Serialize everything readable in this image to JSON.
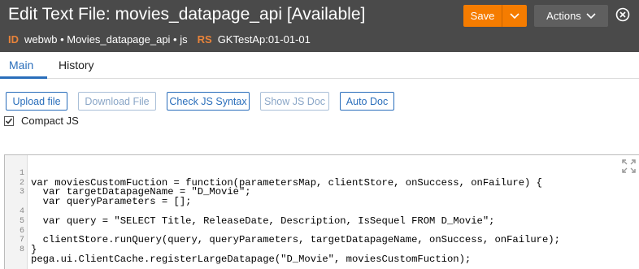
{
  "header": {
    "title": "Edit Text File: movies_datapage_api [Available]",
    "id_tag": "ID",
    "id_value": "webwb • Movies_datapage_api • js",
    "rs_tag": "RS",
    "rs_value": "GKTestAp:01-01-01",
    "save_label": "Save",
    "actions_label": "Actions"
  },
  "tabs": [
    {
      "label": "Main",
      "active": true
    },
    {
      "label": "History",
      "active": false
    }
  ],
  "toolbar": {
    "upload": "Upload file",
    "download": "Download File",
    "check": "Check JS Syntax",
    "show_doc": "Show JS Doc",
    "auto_doc": "Auto Doc"
  },
  "compact": {
    "label": "Compact JS",
    "checked": true
  },
  "editor": {
    "line_numbers": [
      "1",
      "2",
      "3",
      "4",
      "5",
      "6",
      "7",
      "8"
    ],
    "lines": [
      "var moviesCustomFuction = function(parametersMap, clientStore, onSuccess, onFailure) {",
      "  var targetDatapageName = \"D_Movie\";",
      "  var queryParameters = [];",
      "",
      "  var query = \"SELECT Title, ReleaseDate, Description, IsSequel FROM D_Movie\";",
      "",
      "  clientStore.runQuery(query, queryParameters, targetDatapageName, onSuccess, onFailure);",
      "}",
      "pega.ui.ClientCache.registerLargeDatapage(\"D_Movie\", moviesCustomFuction);"
    ]
  },
  "colors": {
    "header_bg": "#4a4a4a",
    "accent": "#f57c00",
    "link_blue": "#2a6ebb",
    "tag_orange": "#e8833a"
  },
  "icons": [
    "chevron-down-icon",
    "close-circle-icon",
    "checkmark-icon",
    "expand-icon"
  ]
}
